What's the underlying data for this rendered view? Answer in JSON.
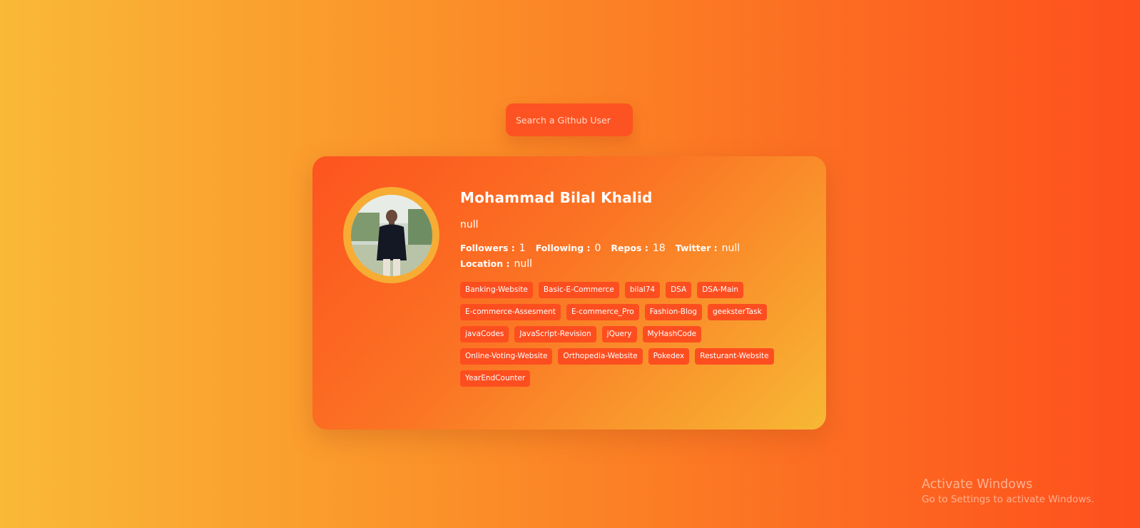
{
  "search": {
    "placeholder": "Search a Github User",
    "value": ""
  },
  "profile": {
    "name": "Mohammad Bilal Khalid",
    "bio": "null",
    "avatar_alt": "user-avatar",
    "stats": {
      "followers_label": "Followers :",
      "followers_value": "1",
      "following_label": "Following :",
      "following_value": "0",
      "repos_label": "Repos :",
      "repos_value": "18",
      "twitter_label": "Twitter :",
      "twitter_value": "null",
      "location_label": "Location :",
      "location_value": "null"
    },
    "repos": [
      "Banking-Website",
      "Basic-E-Commerce",
      "bilal74",
      "DSA",
      "DSA-Main",
      "E-commerce-Assesment",
      "E-commerce_Pro",
      "Fashion-Blog",
      "geeksterTask",
      "javaCodes",
      "JavaScript-Revision",
      "jQuery",
      "MyHashCode",
      "Online-Voting-Website",
      "Orthopedia-Website",
      "Pokedex",
      "Resturant-Website",
      "YearEndCounter"
    ]
  },
  "watermark": {
    "title": "Activate Windows",
    "subtitle": "Go to Settings to activate Windows."
  },
  "colors": {
    "background_left": "#fab937",
    "background_right": "#fe4f1d",
    "card_accent": "#fd541f",
    "repo_tag": "#fd4e20",
    "avatar_ring": "#f7ac33"
  }
}
